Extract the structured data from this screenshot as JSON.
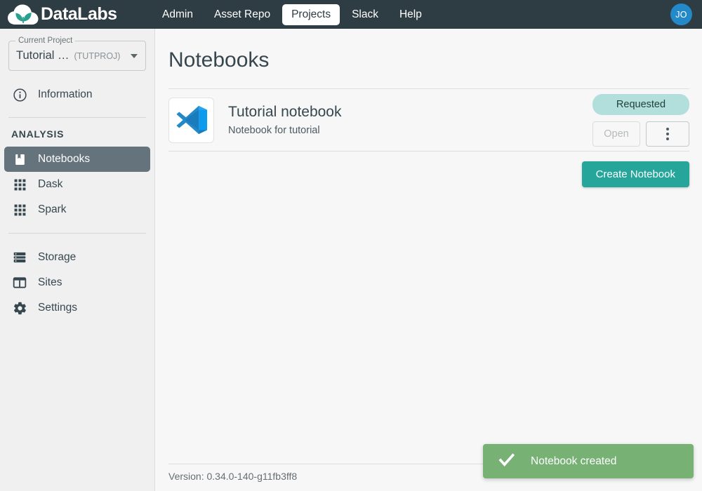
{
  "topnav": {
    "brand": "DataLabs",
    "brand_icon": "cloud-leaf-logo",
    "items": [
      {
        "label": "Admin",
        "active": false
      },
      {
        "label": "Asset Repo",
        "active": false
      },
      {
        "label": "Projects",
        "active": true
      },
      {
        "label": "Slack",
        "active": false
      },
      {
        "label": "Help",
        "active": false
      }
    ],
    "avatar_initials": "JO"
  },
  "sidebar": {
    "project": {
      "legend": "Current Project",
      "value": "Tutorial …",
      "code": "(TUTPROJ)",
      "caret_icon": "chevron-down-icon"
    },
    "information": {
      "label": "Information",
      "icon": "info-icon"
    },
    "section_label": "ANALYSIS",
    "analysis_items": [
      {
        "label": "Notebooks",
        "icon": "book-icon",
        "selected": true
      },
      {
        "label": "Dask",
        "icon": "grid-icon",
        "selected": false
      },
      {
        "label": "Spark",
        "icon": "grid-icon",
        "selected": false
      }
    ],
    "system_items": [
      {
        "label": "Storage",
        "icon": "storage-icon"
      },
      {
        "label": "Sites",
        "icon": "sites-icon"
      },
      {
        "label": "Settings",
        "icon": "gear-icon"
      }
    ]
  },
  "main": {
    "title": "Notebooks",
    "notebook": {
      "icon": "vscode-icon",
      "name": "Tutorial notebook",
      "description": "Notebook for tutorial",
      "status": "Requested",
      "open_label": "Open",
      "menu_icon": "more-vertical-icon"
    },
    "create_label": "Create Notebook",
    "version": "Version: 0.34.0-140-g11fb3ff8"
  },
  "toast": {
    "message": "Notebook created",
    "icon": "check-icon"
  },
  "colors": {
    "nav_bg": "#2e3c43",
    "accent_teal": "#26a69a",
    "badge_bg": "#b2dfdb",
    "toast_bg": "#77b274",
    "avatar_bg": "#2489c9",
    "sidebar_bg": "#f0f0f0",
    "selected_item_bg": "#64737c"
  }
}
